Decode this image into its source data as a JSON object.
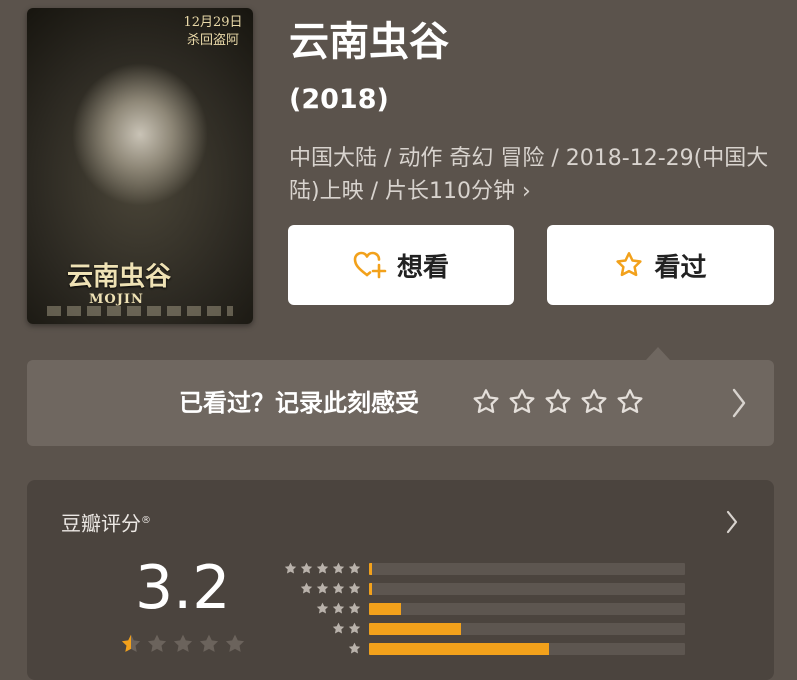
{
  "movie": {
    "title": "云南虫谷",
    "year": "(2018)",
    "meta": "中国大陆 / 动作 奇幻 冒险 / 2018-12-29(中国大陆)上映 / 片长110分钟 ›",
    "poster": {
      "date_line1": "12月29日",
      "date_line2": "杀回盗阿",
      "title": "云南虫谷",
      "subtitle": "MOJIN"
    }
  },
  "actions": {
    "want_label": "想看",
    "seen_label": "看过",
    "accent_color": "#f2a11b"
  },
  "rate_prompt": {
    "label": "已看过？记录此刻感受",
    "star_count": 5
  },
  "rating": {
    "label": "豆瓣评分",
    "registered_mark": "®",
    "score": "3.2",
    "distribution": [
      {
        "stars": 5,
        "fraction": 0.01
      },
      {
        "stars": 4,
        "fraction": 0.01
      },
      {
        "stars": 3,
        "fraction": 0.1
      },
      {
        "stars": 2,
        "fraction": 0.29
      },
      {
        "stars": 1,
        "fraction": 0.57
      }
    ]
  }
}
